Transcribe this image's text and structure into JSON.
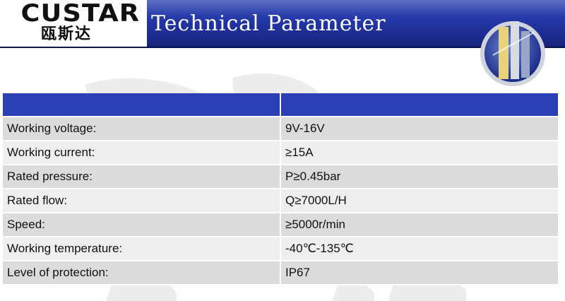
{
  "logo": {
    "latin": "CUSTAR",
    "chinese": "瓯斯达"
  },
  "header": {
    "title": "Technical Parameter"
  },
  "table": {
    "header": [
      "",
      ""
    ],
    "rows": [
      {
        "label": "Working  voltage:",
        "value": "9V-16V"
      },
      {
        "label": "Working current:",
        "value": "≥15A"
      },
      {
        "label": "Rated pressure:",
        "value": "P≥0.45bar"
      },
      {
        "label": "Rated flow:",
        "value": "Q≥7000L/H"
      },
      {
        "label": "Speed:",
        "value": "≥5000r/min"
      },
      {
        "label": "Working temperature:",
        "value": "-40℃-135℃"
      },
      {
        "label": "Level of protection:",
        "value": "IP67"
      }
    ]
  },
  "colors": {
    "header_blue": "#2336a6",
    "table_header": "#2a3fb4",
    "row_dark": "#dcdcde",
    "row_light": "#eeeef0"
  },
  "icons": [
    "building-emblem-icon",
    "world-map-watermark"
  ]
}
